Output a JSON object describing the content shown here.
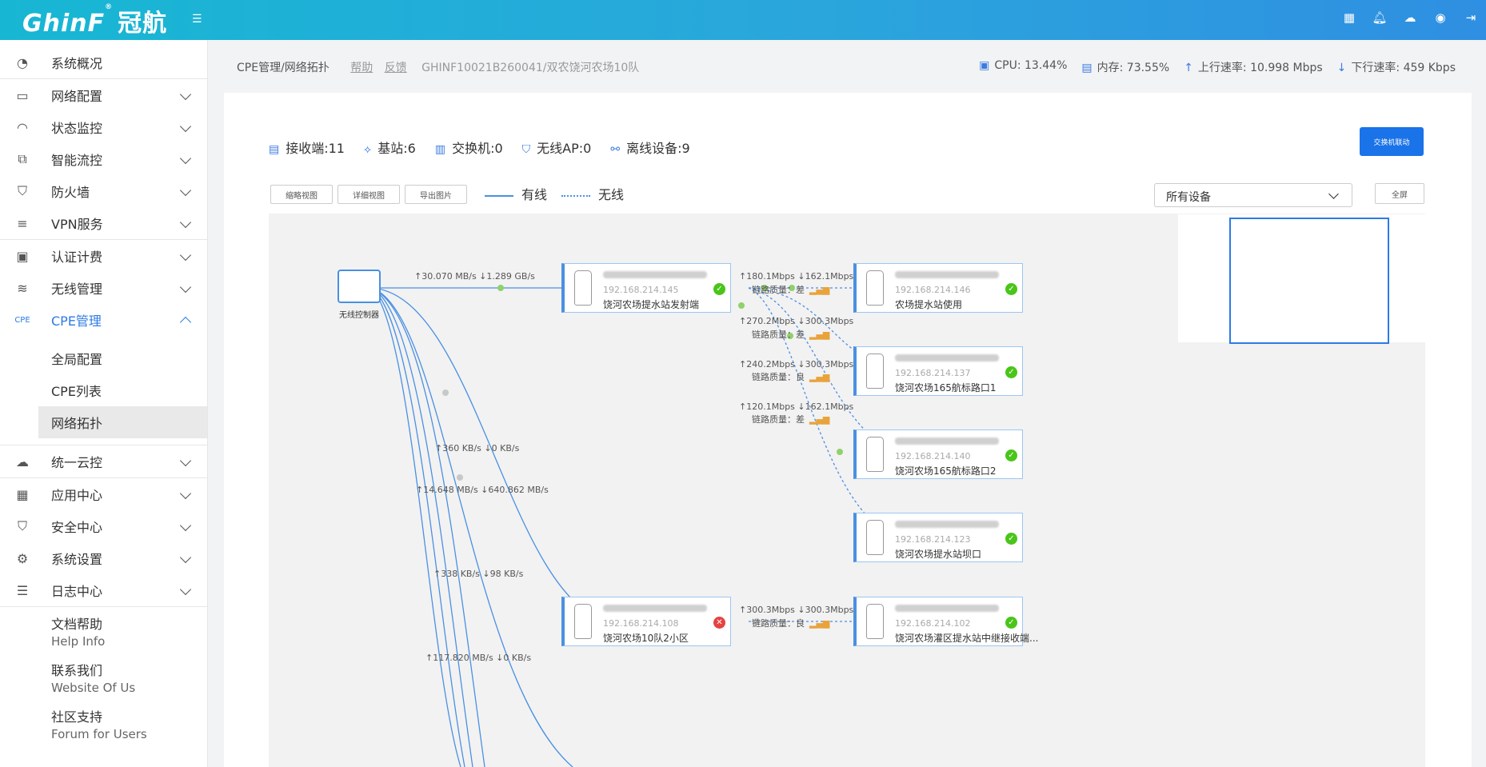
{
  "header": {
    "logo_main": "GhinF",
    "logo_mark": "®",
    "logo_cn": "冠航",
    "icons": [
      "qrcode-icon",
      "bell-icon",
      "cloud-icon",
      "globe-icon",
      "logout-icon"
    ]
  },
  "sidebar": {
    "items": [
      {
        "label": "系统概况",
        "icon": "dashboard-icon"
      },
      {
        "label": "网络配置",
        "icon": "router-icon"
      },
      {
        "label": "状态监控",
        "icon": "gauge-icon"
      },
      {
        "label": "智能流控",
        "icon": "sliders-icon"
      },
      {
        "label": "防火墙",
        "icon": "shield-icon"
      },
      {
        "label": "VPN服务",
        "icon": "vpn-icon"
      },
      {
        "label": "认证计费",
        "icon": "auth-icon"
      },
      {
        "label": "无线管理",
        "icon": "wifi-icon"
      },
      {
        "label": "CPE管理",
        "icon": "cpe-icon"
      }
    ],
    "sub_items": [
      "全局配置",
      "CPE列表",
      "网络拓扑"
    ],
    "items2": [
      {
        "label": "统一云控",
        "icon": "cloud-icon"
      },
      {
        "label": "应用中心",
        "icon": "apps-icon"
      },
      {
        "label": "安全中心",
        "icon": "shield-check-icon"
      },
      {
        "label": "系统设置",
        "icon": "gear-icon"
      },
      {
        "label": "日志中心",
        "icon": "log-icon"
      }
    ],
    "help": [
      {
        "title": "文档帮助",
        "sub": "Help Info"
      },
      {
        "title": "联系我们",
        "sub": "Website Of Us"
      },
      {
        "title": "社区支持",
        "sub": "Forum for Users"
      }
    ]
  },
  "topbar": {
    "breadcrumb": "CPE管理/网络拓扑",
    "help_link": "帮助",
    "feedback_link": "反馈",
    "device": "GHINF10021B260041/双农饶河农场10队",
    "cpu": "CPU: 13.44%",
    "mem": "内存: 73.55%",
    "up": "上行速率: 10.998 Mbps",
    "down": "下行速率: 459 Kbps"
  },
  "counts": {
    "receivers": "接收端:11",
    "stations": "基站:6",
    "switches": "交换机:0",
    "wireless_ap": "无线AP:0",
    "offline": "离线设备:9"
  },
  "toolbar": {
    "btn_thumb": "缩略视图",
    "btn_detail": "详细视图",
    "btn_export": "导出图片",
    "legend_wired": "有线",
    "legend_wireless": "无线",
    "select_value": "所有设备",
    "btn_full": "全屏",
    "btn_switch_link": "交换机联动"
  },
  "topology": {
    "controller": "无线控制器",
    "nodes": [
      {
        "ip": "192.168.214.145",
        "name": "饶河农场提水站发射端",
        "status": "ok"
      },
      {
        "ip": "192.168.214.146",
        "name": "农场提水站使用",
        "status": "ok"
      },
      {
        "ip": "192.168.214.137",
        "name": "饶河农场165航标路口1",
        "status": "ok"
      },
      {
        "ip": "192.168.214.140",
        "name": "饶河农场165航标路口2",
        "status": "ok"
      },
      {
        "ip": "192.168.214.123",
        "name": "饶河农场提水站坝口",
        "status": "ok"
      },
      {
        "ip": "192.168.214.108",
        "name": "饶河农场10队2小区",
        "status": "error"
      },
      {
        "ip": "192.168.214.102",
        "name": "饶河农场灌区提水站中继接收端...",
        "status": "ok"
      }
    ],
    "edge_labels": [
      "↑30.070 MB/s ↓1.289 GB/s",
      "↑180.1Mbps ↓162.1Mbps",
      "↑270.2Mbps ↓300.3Mbps",
      "↑240.2Mbps ↓300.3Mbps",
      "↑120.1Mbps ↓162.1Mbps",
      "↑360 KB/s ↓0 KB/s",
      "↑14.648 MB/s ↓640.862 MB/s",
      "↑338 KB/s ↓98 KB/s",
      "↑300.3Mbps ↓300.3Mbps",
      "↑117.820 MB/s ↓0 KB/s"
    ],
    "quality_labels": [
      "链路质量：差",
      "链路质量：差",
      "链路质量：良",
      "链路质量：差",
      "链路质量：良"
    ]
  }
}
